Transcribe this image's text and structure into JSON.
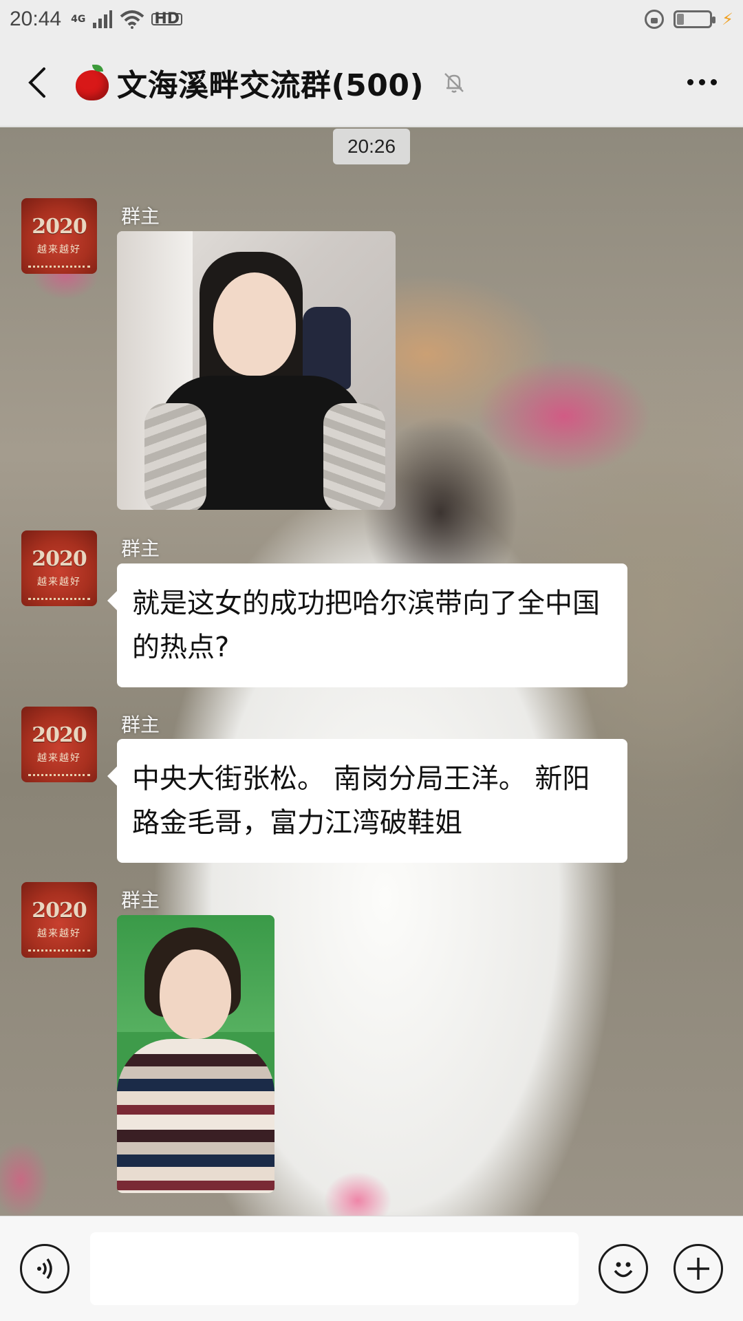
{
  "status_bar": {
    "time": "20:44",
    "network": "4G",
    "hd": "HD",
    "bolt": "⚡"
  },
  "header": {
    "title": "文海溪畔交流群(500)",
    "icons": [
      "back-arrow-icon",
      "red-apple-icon",
      "muted-bell-icon",
      "more-dots-icon"
    ]
  },
  "chat": {
    "timestamp": "20:26",
    "messages": [
      {
        "sender": "群主",
        "type": "image",
        "avatar_year": "2020",
        "avatar_tagline": "越来越好"
      },
      {
        "sender": "群主",
        "type": "text",
        "text": "就是这女的成功把哈尔滨带向了全中国的热点?",
        "avatar_year": "2020",
        "avatar_tagline": "越来越好"
      },
      {
        "sender": "群主",
        "type": "text",
        "text": "中央大街张松。 南岗分局王洋。 新阳路金毛哥，富力江湾破鞋姐",
        "avatar_year": "2020",
        "avatar_tagline": "越来越好"
      },
      {
        "sender": "群主",
        "type": "image",
        "avatar_year": "2020",
        "avatar_tagline": "越来越好"
      }
    ]
  },
  "input_bar": {
    "value": "",
    "icons": [
      "voice-icon",
      "emoji-icon",
      "plus-icon"
    ]
  }
}
